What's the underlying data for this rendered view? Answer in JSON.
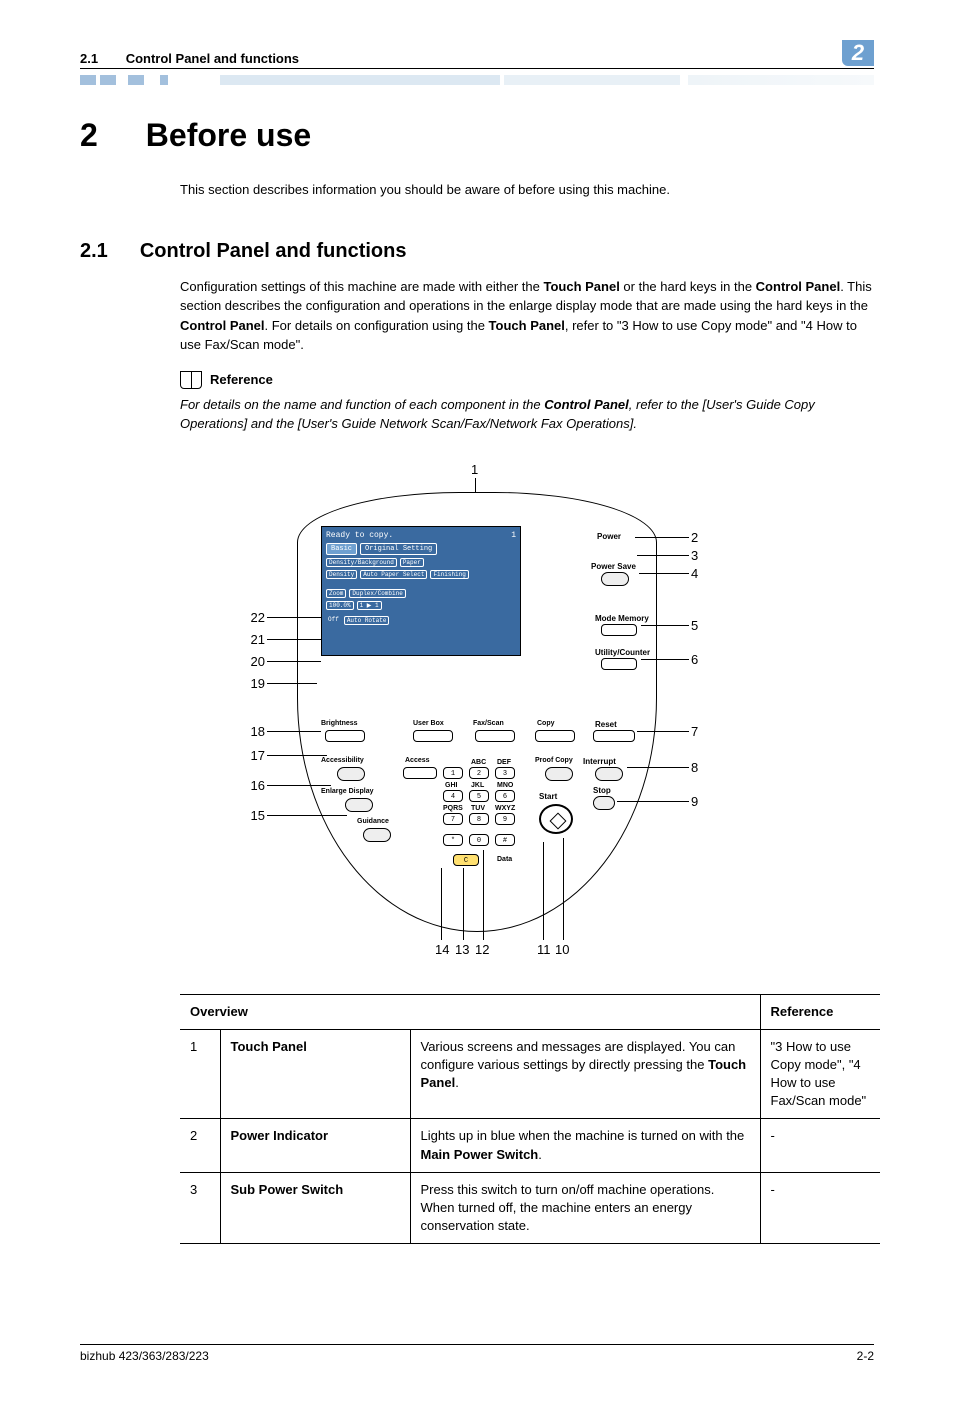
{
  "header": {
    "section_num": "2.1",
    "section_name": "Control Panel and functions",
    "chapter_badge": "2"
  },
  "title": {
    "num": "2",
    "text": "Before use"
  },
  "intro": "This section describes information you should be aware of before using this machine.",
  "subtitle": {
    "num": "2.1",
    "text": "Control Panel and functions"
  },
  "body1_a": "Configuration settings of this machine are made with either the ",
  "body1_b": "Touch Panel",
  "body1_c": " or the hard keys in the ",
  "body1_d": "Control Panel",
  "body1_e": ". This section describes the configuration and operations in the enlarge display mode that are made using the hard keys in the ",
  "body1_f": "Control Panel",
  "body1_g": ". For details on configuration using the ",
  "body1_h": "Touch Panel",
  "body1_i": ", refer to \"3 How to use Copy mode\" and \"4 How to use Fax/Scan mode\".",
  "reference_label": "Reference",
  "ref_body_a": "For details on the name and function of each component in the ",
  "ref_body_b": "Control Panel",
  "ref_body_c": ", refer to the [User's Guide Copy Operations] and the [User's Guide Network Scan/Fax/Network Fax Operations].",
  "figure": {
    "top_callout": "1",
    "right": [
      "2",
      "3",
      "4",
      "5",
      "6",
      "7",
      "8",
      "9"
    ],
    "left": [
      "22",
      "21",
      "20",
      "19",
      "18",
      "17",
      "16",
      "15"
    ],
    "bottom": [
      "14",
      "13",
      "12",
      "11",
      "10"
    ],
    "screen": {
      "status": "Ready to copy.",
      "count": "1",
      "tab_basic": "Basic",
      "tab_orig": "Original Setting",
      "density_bg": "Density/Background",
      "density": "Density",
      "paper": "Paper",
      "auto_paper": "Auto Paper Select",
      "finishing": "Finishing",
      "zoom": "Zoom",
      "zoom_val": "100.0%",
      "duplex": "Duplex/Combine",
      "duplex_val": "1 ▶ 1",
      "rotate": "Auto Rotate",
      "off": "Off"
    },
    "panel": {
      "power": "Power",
      "power_save": "Power Save",
      "mode_memory": "Mode Memory",
      "utility": "Utility/Counter",
      "reset": "Reset",
      "interrupt": "Interrupt",
      "stop": "Stop",
      "start": "Start",
      "proof": "Proof Copy",
      "userbox": "User Box",
      "faxscan": "Fax/Scan",
      "copy": "Copy",
      "brightness": "Brightness",
      "access": "Accessibility",
      "accessbtn": "Access",
      "enlarge": "Enlarge Display",
      "guidance": "Guidance",
      "data": "Data",
      "c_key": "C",
      "k1": "1",
      "k2": "2",
      "k3": "3",
      "k4": "4",
      "k5": "5",
      "k6": "6",
      "k7": "7",
      "k8": "8",
      "k9": "9",
      "k0": "0",
      "ks": "*",
      "kh": "#",
      "abc": "ABC",
      "def": "DEF",
      "ghi": "GHI",
      "jkl": "JKL",
      "mno": "MNO",
      "pqrs": "PQRS",
      "tuv": "TUV",
      "wxyz": "WXYZ"
    }
  },
  "table": {
    "head_overview": "Overview",
    "head_ref": "Reference",
    "rows": [
      {
        "num": "1",
        "name": "Touch Panel",
        "desc_a": "Various screens and messages are displayed. You can configure various settings by directly pressing the ",
        "desc_b": "Touch Panel",
        "desc_c": ".",
        "ref": "\"3 How to use Copy mode\", \"4 How to use Fax/Scan mode\""
      },
      {
        "num": "2",
        "name": "Power Indicator",
        "desc_a": "Lights up in blue when the machine is turned on with the ",
        "desc_b": "Main Power Switch",
        "desc_c": ".",
        "ref": "-"
      },
      {
        "num": "3",
        "name": "Sub Power Switch",
        "desc_a": "Press this switch to turn on/off machine operations. When turned off, the machine enters an energy conservation state.",
        "desc_b": "",
        "desc_c": "",
        "ref": "-"
      }
    ]
  },
  "footer": {
    "left": "bizhub 423/363/283/223",
    "right": "2-2"
  }
}
